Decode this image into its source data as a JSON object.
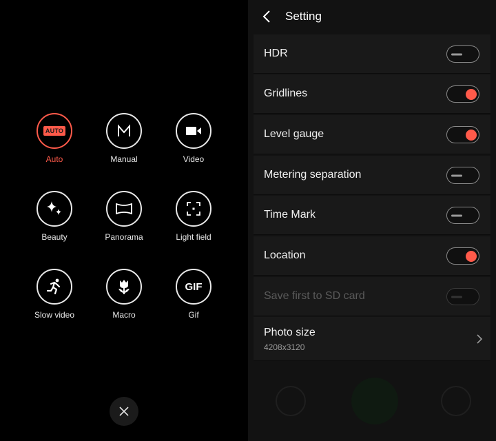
{
  "modes": [
    {
      "label": "Auto",
      "icon": "auto-badge-icon",
      "badge": "AUTO",
      "active": true
    },
    {
      "label": "Manual",
      "icon": "manual-m-icon",
      "active": false
    },
    {
      "label": "Video",
      "icon": "video-camera-icon",
      "active": false
    },
    {
      "label": "Beauty",
      "icon": "sparkle-icon",
      "active": false
    },
    {
      "label": "Panorama",
      "icon": "panorama-icon",
      "active": false
    },
    {
      "label": "Light field",
      "icon": "focus-frame-icon",
      "active": false
    },
    {
      "label": "Slow video",
      "icon": "running-person-icon",
      "active": false
    },
    {
      "label": "Macro",
      "icon": "flower-icon",
      "active": false
    },
    {
      "label": "Gif",
      "icon": "gif-icon",
      "badge": "GIF",
      "active": false
    }
  ],
  "close_icon": "close-icon",
  "settings": {
    "title": "Setting",
    "back_icon": "back-arrow-icon",
    "rows": [
      {
        "label": "HDR",
        "state": "off"
      },
      {
        "label": "Gridlines",
        "state": "on"
      },
      {
        "label": "Level gauge",
        "state": "on"
      },
      {
        "label": "Metering separation",
        "state": "off"
      },
      {
        "label": "Time Mark",
        "state": "off"
      },
      {
        "label": "Location",
        "state": "on"
      },
      {
        "label": "Save first to SD card",
        "state": "disabled"
      }
    ],
    "photo_size": {
      "label": "Photo size",
      "value": "4208x3120"
    }
  },
  "colors": {
    "accent": "#ff5a4a",
    "panel": "#191919",
    "background": "#121212"
  }
}
